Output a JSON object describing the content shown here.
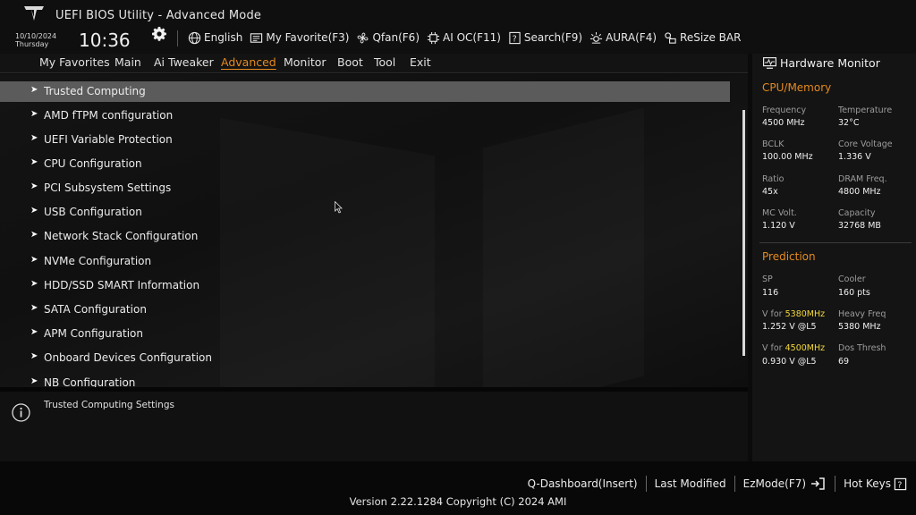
{
  "header": {
    "title": "UEFI BIOS Utility - Advanced Mode",
    "date": "10/10/2024",
    "day": "Thursday",
    "time": "10:36",
    "toolbar": [
      {
        "icon": "globe-icon",
        "label": "English"
      },
      {
        "icon": "favorite-icon",
        "label": "My Favorite(F3)"
      },
      {
        "icon": "fan-icon",
        "label": "Qfan(F6)"
      },
      {
        "icon": "ai-oc-icon",
        "label": "AI OC(F11)"
      },
      {
        "icon": "search-icon",
        "label": "Search(F9)"
      },
      {
        "icon": "aura-icon",
        "label": "AURA(F4)"
      },
      {
        "icon": "resize-bar-icon",
        "label": "ReSize BAR"
      }
    ]
  },
  "menu": {
    "items": [
      "My Favorites",
      "Main",
      "Ai Tweaker",
      "Advanced",
      "Monitor",
      "Boot",
      "Tool",
      "Exit"
    ],
    "active": "Advanced",
    "active_color": "#e58a1f"
  },
  "list": {
    "items": [
      "Trusted Computing",
      "AMD fTPM configuration",
      "UEFI Variable Protection",
      "CPU Configuration",
      "PCI Subsystem Settings",
      "USB Configuration",
      "Network Stack Configuration",
      "NVMe Configuration",
      "HDD/SSD SMART Information",
      "SATA Configuration",
      "APM Configuration",
      "Onboard Devices Configuration",
      "NB Configuration"
    ],
    "selected": "Trusted Computing"
  },
  "help": {
    "text": "Trusted Computing Settings"
  },
  "hardware_monitor": {
    "title": "Hardware Monitor",
    "cpu_memory": {
      "title": "CPU/Memory",
      "frequency_label": "Frequency",
      "frequency": "4500 MHz",
      "temperature_label": "Temperature",
      "temperature": "32°C",
      "bclk_label": "BCLK",
      "bclk": "100.00 MHz",
      "core_voltage_label": "Core Voltage",
      "core_voltage": "1.336 V",
      "ratio_label": "Ratio",
      "ratio": "45x",
      "dram_freq_label": "DRAM Freq.",
      "dram_freq": "4800 MHz",
      "mc_volt_label": "MC Volt.",
      "mc_volt": "1.120 V",
      "capacity_label": "Capacity",
      "capacity": "32768 MB"
    },
    "prediction": {
      "title": "Prediction",
      "sp_label": "SP",
      "sp": "116",
      "cooler_label": "Cooler",
      "cooler": "160 pts",
      "v1_prefix": "V for ",
      "v1_freq": "5380MHz",
      "v1": "1.252 V @L5",
      "heavy_freq_label": "Heavy Freq",
      "heavy_freq": "5380 MHz",
      "v2_prefix": "V for ",
      "v2_freq": "4500MHz",
      "v2": "0.930 V @L5",
      "dos_thresh_label": "Dos Thresh",
      "dos_thresh": "69"
    },
    "accent_color": "#e58a1f",
    "highlight_color": "#f3d83a"
  },
  "footer": {
    "links": [
      "Q-Dashboard(Insert)",
      "Last Modified",
      "EzMode(F7)",
      "Hot Keys"
    ],
    "version": "Version 2.22.1284 Copyright (C) 2024 AMI"
  }
}
